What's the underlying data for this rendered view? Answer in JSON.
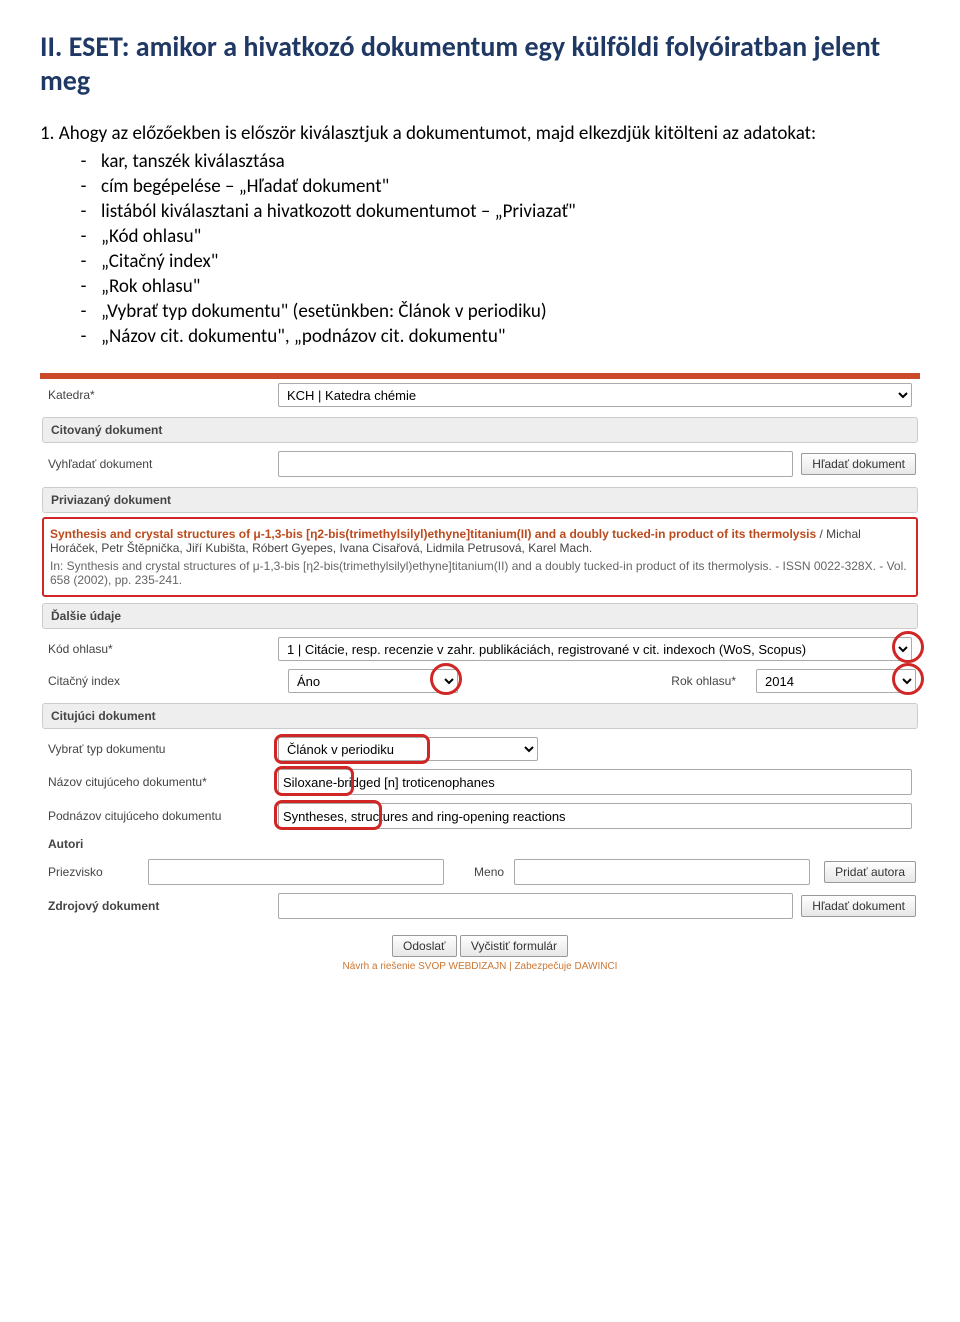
{
  "heading": "II. ESET: amikor a hivatkozó dokumentum egy külföldi folyóiratban jelent meg",
  "intro": "1. Ahogy az előzőekben is először kiválasztjuk a dokumentumot, majd elkezdjük kitölteni az adatokat:",
  "list": [
    "kar, tanszék kiválasztása",
    "cím begépelése – „Hľadať dokument\"",
    "listából kiválasztani a hivatkozott dokumentumot – „Priviazať\"",
    "„Kód ohlasu\"",
    "„Citačný index\"",
    "„Rok ohlasu\"",
    "„Vybrať typ dokumentu\" (esetünkben: Článok v periodiku)",
    "„Názov cit. dokumentu\", „podnázov cit. dokumentu\""
  ],
  "form": {
    "katedra_label": "Katedra*",
    "katedra_value": "KCH | Katedra chémie",
    "citovany_header": "Citovaný dokument",
    "vyhladat_label": "Vyhľadať dokument",
    "hladat_btn": "Hľadať dokument",
    "priviazany_header": "Priviazaný dokument",
    "bound_title": "Synthesis and crystal structures of μ-1,3-bis [η2-bis(trimethylsilyl)ethyne]titanium(II) and a doubly tucked-in product of its thermolysis",
    "bound_authors": " / Michal Horáček, Petr Štěpnička, Jiří Kubišta, Róbert Gyepes, Ivana Cisařová, Lidmila Petrusová, Karel Mach.",
    "bound_in": "In: Synthesis and crystal structures of μ-1,3-bis [η2-bis(trimethylsilyl)ethyne]titanium(II) and a doubly tucked-in product of its thermolysis. - ISSN 0022-328X. - Vol. 658 (2002), pp. 235-241.",
    "dalsie_header": "Ďalšie údaje",
    "kod_label": "Kód ohlasu*",
    "kod_value": "1 | Citácie, resp. recenzie v zahr. publikáciách, registrované v cit. indexoch (WoS, Scopus)",
    "citindex_label": "Citačný index",
    "citindex_value": "Áno",
    "rok_label": "Rok ohlasu*",
    "rok_value": "2014",
    "citujuci_header": "Citujúci dokument",
    "typ_label": "Vybrať typ dokumentu",
    "typ_value": "Článok v periodiku",
    "nazov_label": "Názov citujúceho dokumentu*",
    "nazov_value": "Siloxane-bridged [n] troticenophanes",
    "podnazov_label": "Podnázov citujúceho dokumentu",
    "podnazov_value": "Syntheses, structures and ring-opening reactions",
    "autori_label": "Autori",
    "priezvisko_label": "Priezvisko",
    "meno_label": "Meno",
    "pridat_btn": "Pridať autora",
    "zdroj_label": "Zdrojový dokument",
    "odoslat_btn": "Odoslať",
    "vycistit_btn": "Vyčistiť formulár",
    "credit": "Návrh a riešenie SVOP WEBDIZAJN | Zabezpečuje DAWINCI"
  }
}
